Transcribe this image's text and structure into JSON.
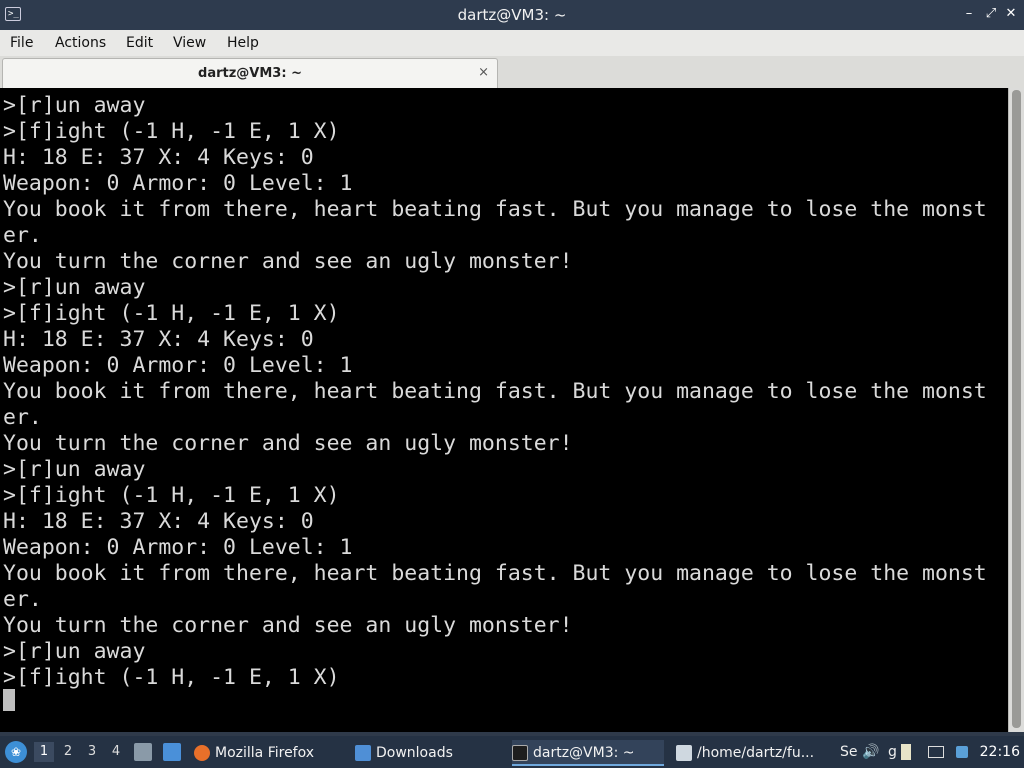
{
  "window": {
    "title": "dartz@VM3: ~",
    "icon": "terminal-icon",
    "controls": {
      "minimize": "–",
      "maximize": "✕",
      "close": "✕"
    }
  },
  "menu": {
    "file": "File",
    "actions": "Actions",
    "edit": "Edit",
    "view": "View",
    "help": "Help"
  },
  "tab": {
    "label": "dartz@VM3: ~",
    "close": "×"
  },
  "terminal": {
    "lines": [
      ">[r]un away",
      ">[f]ight (-1 H, -1 E, 1 X)",
      "H: 18 E: 37 X: 4 Keys: 0",
      "Weapon: 0 Armor: 0 Level: 1",
      "You book it from there, heart beating fast. But you manage to lose the monst",
      "er.",
      "You turn the corner and see an ugly monster!",
      ">[r]un away",
      ">[f]ight (-1 H, -1 E, 1 X)",
      "H: 18 E: 37 X: 4 Keys: 0",
      "Weapon: 0 Armor: 0 Level: 1",
      "You book it from there, heart beating fast. But you manage to lose the monst",
      "er.",
      "You turn the corner and see an ugly monster!",
      ">[r]un away",
      ">[f]ight (-1 H, -1 E, 1 X)",
      "H: 18 E: 37 X: 4 Keys: 0",
      "Weapon: 0 Armor: 0 Level: 1",
      "You book it from there, heart beating fast. But you manage to lose the monst",
      "er.",
      "You turn the corner and see an ugly monster!",
      ">[r]un away",
      ">[f]ight (-1 H, -1 E, 1 X)"
    ]
  },
  "taskbar": {
    "workspaces": [
      "1",
      "2",
      "3",
      "4"
    ],
    "active_workspace": "1",
    "tasks": {
      "firefox": "Mozilla Firefox",
      "downloads": "Downloads",
      "terminal": "dartz@VM3: ~",
      "editor": "/home/dartz/fu..."
    },
    "tray": {
      "se": "Se",
      "g": "g"
    },
    "clock": "22:16"
  },
  "colors": {
    "terminal_bg": "#000000",
    "terminal_fg": "#dadada",
    "titlebar": "#2e3b4e",
    "taskbar": "#253244"
  }
}
